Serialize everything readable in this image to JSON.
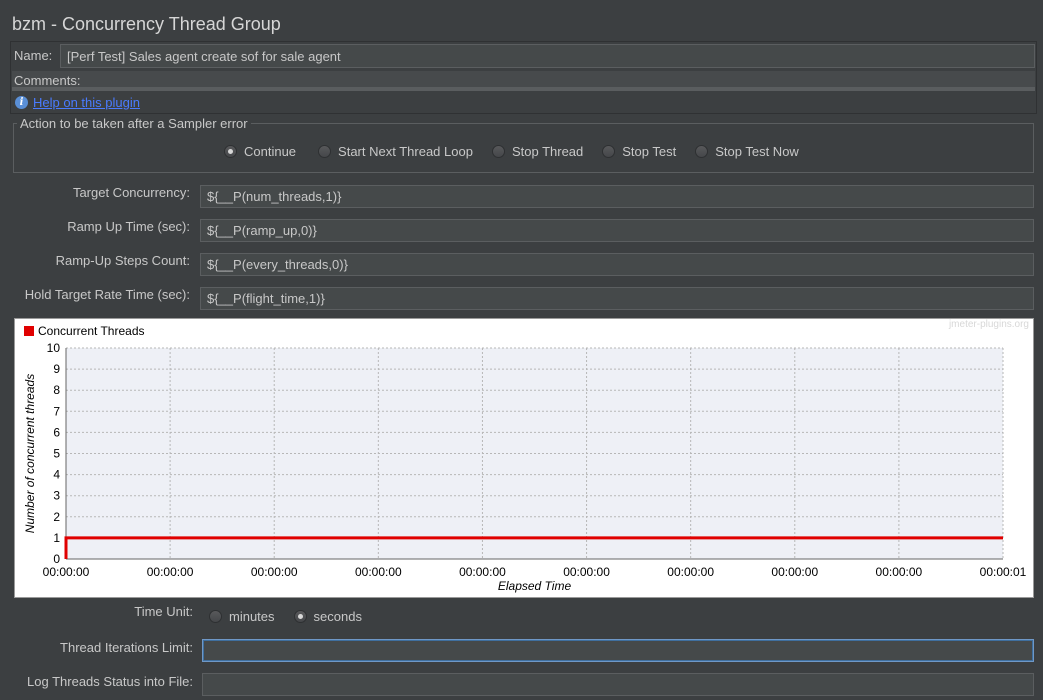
{
  "window": {
    "title": "bzm - Concurrency Thread Group"
  },
  "name": {
    "label": "Name:",
    "value": "[Perf Test] Sales agent create sof for sale agent"
  },
  "comments": {
    "label": "Comments:",
    "value": ""
  },
  "help": {
    "icon": "info-icon",
    "link_text": "Help on this plugin"
  },
  "sampler_error": {
    "legend": "Action to be taken after a Sampler error",
    "options": [
      "Continue",
      "Start Next Thread Loop",
      "Stop Thread",
      "Stop Test",
      "Stop Test Now"
    ],
    "selected": "Continue"
  },
  "params": {
    "target_concurrency": {
      "label": "Target Concurrency:",
      "value": "${__P(num_threads,1)}"
    },
    "ramp_up_time": {
      "label": "Ramp Up Time (sec):",
      "value": "${__P(ramp_up,0)}"
    },
    "ramp_up_steps": {
      "label": "Ramp-Up Steps Count:",
      "value": "${__P(every_threads,0)}"
    },
    "hold_target": {
      "label": "Hold Target Rate Time (sec):",
      "value": "${__P(flight_time,1)}"
    }
  },
  "chart_data": {
    "type": "line",
    "title": "",
    "watermark": "jmeter-plugins.org",
    "xlabel": "Elapsed Time",
    "ylabel": "Number of concurrent threads",
    "ylim": [
      0,
      10
    ],
    "y_ticks": [
      "0",
      "1",
      "2",
      "3",
      "4",
      "5",
      "6",
      "7",
      "8",
      "9",
      "10"
    ],
    "x_ticks": [
      "00:00:00",
      "00:00:00",
      "00:00:00",
      "00:00:00",
      "00:00:00",
      "00:00:00",
      "00:00:00",
      "00:00:00",
      "00:00:00",
      "00:00:01"
    ],
    "legend_position": "top-left",
    "grid": true,
    "series": [
      {
        "name": "Concurrent Threads",
        "color": "#e00000",
        "points": [
          {
            "x": 0,
            "y": 0
          },
          {
            "x": 0,
            "y": 1
          },
          {
            "x": 1,
            "y": 1
          }
        ]
      }
    ],
    "xlim": [
      0,
      1
    ]
  },
  "time_unit": {
    "label": "Time Unit:",
    "options": [
      "minutes",
      "seconds"
    ],
    "selected": "seconds"
  },
  "thread_iterations": {
    "label": "Thread Iterations Limit:",
    "value": ""
  },
  "log_threads": {
    "label": "Log Threads Status into File:",
    "value": ""
  }
}
